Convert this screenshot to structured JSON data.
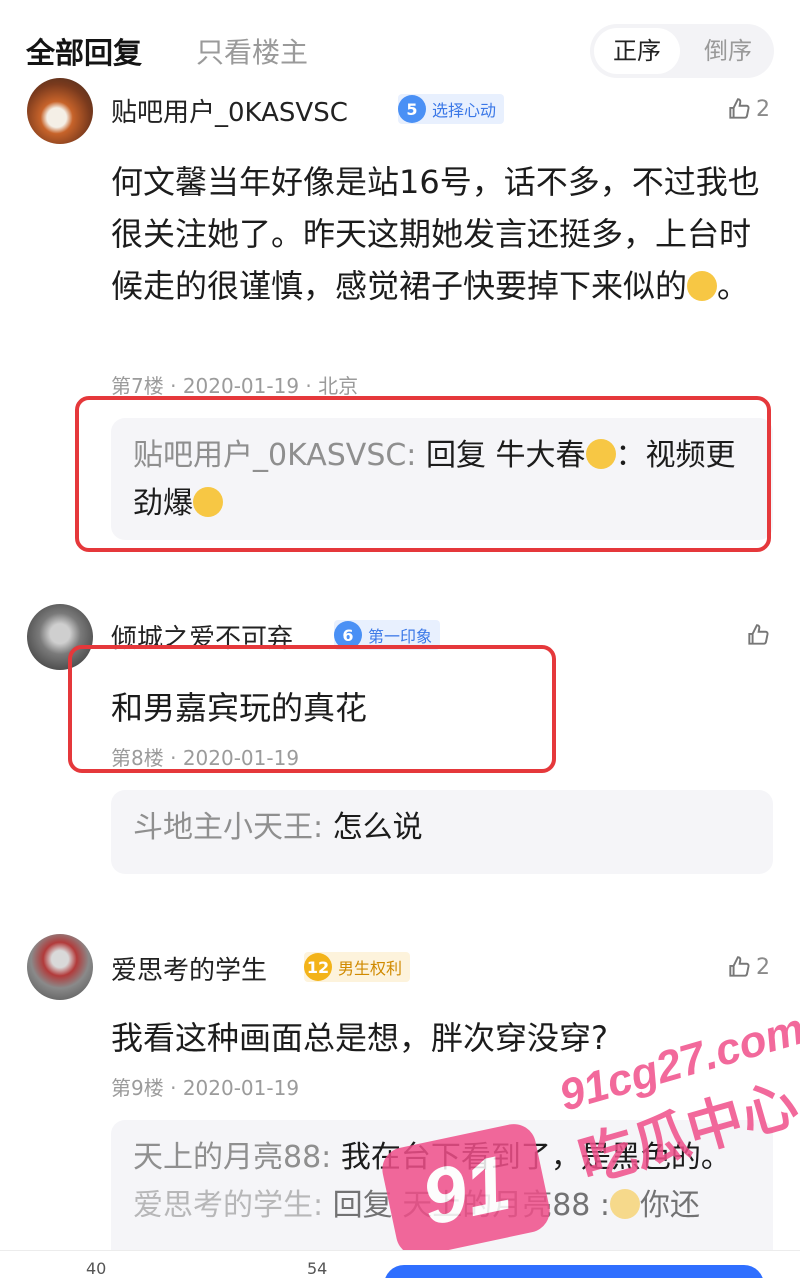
{
  "header": {
    "tab_all": "全部回复",
    "tab_owner": "只看楼主",
    "sort_asc": "正序",
    "sort_desc": "倒序"
  },
  "posts": [
    {
      "username": "贴吧用户_0KASVSC",
      "level": "5",
      "level_title": "选择心动",
      "likes": "2",
      "content": "何文馨当年好像是站16号，话不多，不过我也很关注她了。昨天这期她发言还挺多，上台时候走的很谨慎，感觉裙子快要掉下来似的",
      "content_end": "。",
      "floor": "第7楼",
      "date": "2020-01-19",
      "location": "北京",
      "reply": {
        "user": "贴吧用户_0KASVSC:",
        "prefix": "回复 牛大春",
        "text_after": "：视频更劲爆"
      }
    },
    {
      "username": "倾城之爱不可弃",
      "level": "6",
      "level_title": "第一印象",
      "likes": "",
      "content": "和男嘉宾玩的真花",
      "floor": "第8楼",
      "date": "2020-01-19",
      "reply": {
        "user": "斗地主小天王:",
        "text": "怎么说"
      }
    },
    {
      "username": "爱思考的学生",
      "level": "12",
      "level_title": "男生权利",
      "likes": "2",
      "content": "我看这种画面总是想，胖次穿没穿?",
      "floor": "第9楼",
      "date": "2020-01-19",
      "reply": {
        "user": "天上的月亮88:",
        "text": "我在台下看到了，是黑色的。",
        "line2_user": "爱思考的学生:",
        "line2_text": "回复 天上的月亮88 :",
        "line2_tail": "你还"
      }
    }
  ],
  "watermark": {
    "number": "91",
    "domain": "91cg27.com",
    "name": "吃瓜中心"
  },
  "bottom": {
    "count_left": "40",
    "count_mid": "54"
  },
  "colors": {
    "highlight_frame": "#e5383b",
    "badge_blue": "#4a90f5",
    "badge_gold": "#f3b319",
    "watermark_pink": "#f04f8a",
    "primary_button": "#2f6fff"
  },
  "separator": "·"
}
